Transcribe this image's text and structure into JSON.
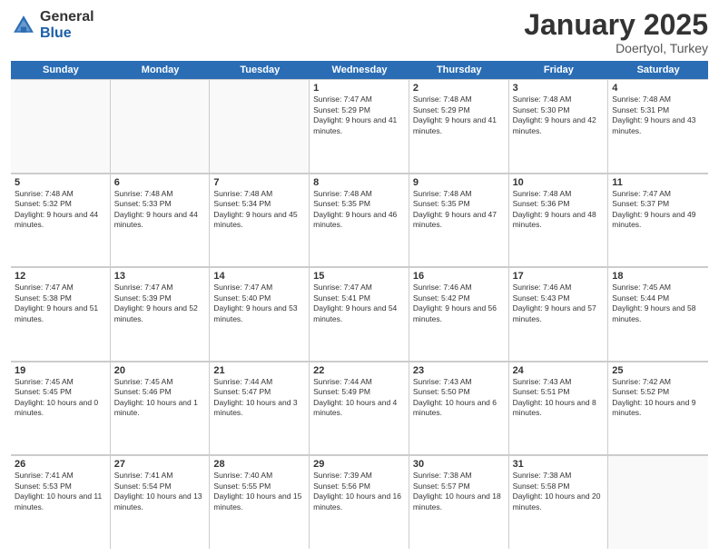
{
  "logo": {
    "general": "General",
    "blue": "Blue"
  },
  "title": "January 2025",
  "location": "Doertyol, Turkey",
  "header_days": [
    "Sunday",
    "Monday",
    "Tuesday",
    "Wednesday",
    "Thursday",
    "Friday",
    "Saturday"
  ],
  "weeks": [
    [
      {
        "day": "",
        "text": ""
      },
      {
        "day": "",
        "text": ""
      },
      {
        "day": "",
        "text": ""
      },
      {
        "day": "1",
        "text": "Sunrise: 7:47 AM\nSunset: 5:29 PM\nDaylight: 9 hours and 41 minutes."
      },
      {
        "day": "2",
        "text": "Sunrise: 7:48 AM\nSunset: 5:29 PM\nDaylight: 9 hours and 41 minutes."
      },
      {
        "day": "3",
        "text": "Sunrise: 7:48 AM\nSunset: 5:30 PM\nDaylight: 9 hours and 42 minutes."
      },
      {
        "day": "4",
        "text": "Sunrise: 7:48 AM\nSunset: 5:31 PM\nDaylight: 9 hours and 43 minutes."
      }
    ],
    [
      {
        "day": "5",
        "text": "Sunrise: 7:48 AM\nSunset: 5:32 PM\nDaylight: 9 hours and 44 minutes."
      },
      {
        "day": "6",
        "text": "Sunrise: 7:48 AM\nSunset: 5:33 PM\nDaylight: 9 hours and 44 minutes."
      },
      {
        "day": "7",
        "text": "Sunrise: 7:48 AM\nSunset: 5:34 PM\nDaylight: 9 hours and 45 minutes."
      },
      {
        "day": "8",
        "text": "Sunrise: 7:48 AM\nSunset: 5:35 PM\nDaylight: 9 hours and 46 minutes."
      },
      {
        "day": "9",
        "text": "Sunrise: 7:48 AM\nSunset: 5:35 PM\nDaylight: 9 hours and 47 minutes."
      },
      {
        "day": "10",
        "text": "Sunrise: 7:48 AM\nSunset: 5:36 PM\nDaylight: 9 hours and 48 minutes."
      },
      {
        "day": "11",
        "text": "Sunrise: 7:47 AM\nSunset: 5:37 PM\nDaylight: 9 hours and 49 minutes."
      }
    ],
    [
      {
        "day": "12",
        "text": "Sunrise: 7:47 AM\nSunset: 5:38 PM\nDaylight: 9 hours and 51 minutes."
      },
      {
        "day": "13",
        "text": "Sunrise: 7:47 AM\nSunset: 5:39 PM\nDaylight: 9 hours and 52 minutes."
      },
      {
        "day": "14",
        "text": "Sunrise: 7:47 AM\nSunset: 5:40 PM\nDaylight: 9 hours and 53 minutes."
      },
      {
        "day": "15",
        "text": "Sunrise: 7:47 AM\nSunset: 5:41 PM\nDaylight: 9 hours and 54 minutes."
      },
      {
        "day": "16",
        "text": "Sunrise: 7:46 AM\nSunset: 5:42 PM\nDaylight: 9 hours and 56 minutes."
      },
      {
        "day": "17",
        "text": "Sunrise: 7:46 AM\nSunset: 5:43 PM\nDaylight: 9 hours and 57 minutes."
      },
      {
        "day": "18",
        "text": "Sunrise: 7:45 AM\nSunset: 5:44 PM\nDaylight: 9 hours and 58 minutes."
      }
    ],
    [
      {
        "day": "19",
        "text": "Sunrise: 7:45 AM\nSunset: 5:45 PM\nDaylight: 10 hours and 0 minutes."
      },
      {
        "day": "20",
        "text": "Sunrise: 7:45 AM\nSunset: 5:46 PM\nDaylight: 10 hours and 1 minute."
      },
      {
        "day": "21",
        "text": "Sunrise: 7:44 AM\nSunset: 5:47 PM\nDaylight: 10 hours and 3 minutes."
      },
      {
        "day": "22",
        "text": "Sunrise: 7:44 AM\nSunset: 5:49 PM\nDaylight: 10 hours and 4 minutes."
      },
      {
        "day": "23",
        "text": "Sunrise: 7:43 AM\nSunset: 5:50 PM\nDaylight: 10 hours and 6 minutes."
      },
      {
        "day": "24",
        "text": "Sunrise: 7:43 AM\nSunset: 5:51 PM\nDaylight: 10 hours and 8 minutes."
      },
      {
        "day": "25",
        "text": "Sunrise: 7:42 AM\nSunset: 5:52 PM\nDaylight: 10 hours and 9 minutes."
      }
    ],
    [
      {
        "day": "26",
        "text": "Sunrise: 7:41 AM\nSunset: 5:53 PM\nDaylight: 10 hours and 11 minutes."
      },
      {
        "day": "27",
        "text": "Sunrise: 7:41 AM\nSunset: 5:54 PM\nDaylight: 10 hours and 13 minutes."
      },
      {
        "day": "28",
        "text": "Sunrise: 7:40 AM\nSunset: 5:55 PM\nDaylight: 10 hours and 15 minutes."
      },
      {
        "day": "29",
        "text": "Sunrise: 7:39 AM\nSunset: 5:56 PM\nDaylight: 10 hours and 16 minutes."
      },
      {
        "day": "30",
        "text": "Sunrise: 7:38 AM\nSunset: 5:57 PM\nDaylight: 10 hours and 18 minutes."
      },
      {
        "day": "31",
        "text": "Sunrise: 7:38 AM\nSunset: 5:58 PM\nDaylight: 10 hours and 20 minutes."
      },
      {
        "day": "",
        "text": ""
      }
    ]
  ]
}
